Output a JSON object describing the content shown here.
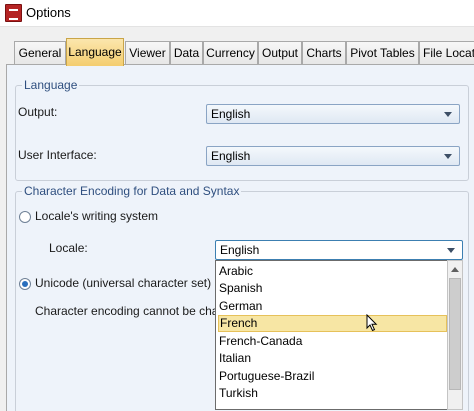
{
  "window": {
    "title": "Options"
  },
  "tabs": [
    {
      "label": "General"
    },
    {
      "label": "Language",
      "active": true
    },
    {
      "label": "Viewer"
    },
    {
      "label": "Data"
    },
    {
      "label": "Currency"
    },
    {
      "label": "Output"
    },
    {
      "label": "Charts"
    },
    {
      "label": "Pivot Tables"
    },
    {
      "label": "File Locat"
    }
  ],
  "language_group": {
    "title": "Language",
    "output_label": "Output:",
    "output_value": "English",
    "ui_label": "User Interface:",
    "ui_value": "English"
  },
  "encoding_group": {
    "title": "Character Encoding for Data and Syntax",
    "locale_radio_label": "Locale's writing system",
    "locale_label": "Locale:",
    "locale_value": "English",
    "unicode_radio_label": "Unicode (universal character set)",
    "unicode_selected": true,
    "note": "Character encoding cannot be changed"
  },
  "locale_dropdown": {
    "options": [
      "Arabic",
      "Spanish",
      "German",
      "French",
      "French-Canada",
      "Italian",
      "Portuguese-Brazil",
      "Turkish"
    ],
    "highlighted": "French"
  },
  "icons": {
    "app": "app-icon",
    "combo_arrow": "chevron-down-icon",
    "cursor": "mouse-pointer-icon"
  },
  "colors": {
    "active_tab": "#f4cd6f",
    "highlight": "#f7e6a4",
    "group_title": "#2f4f7f"
  }
}
